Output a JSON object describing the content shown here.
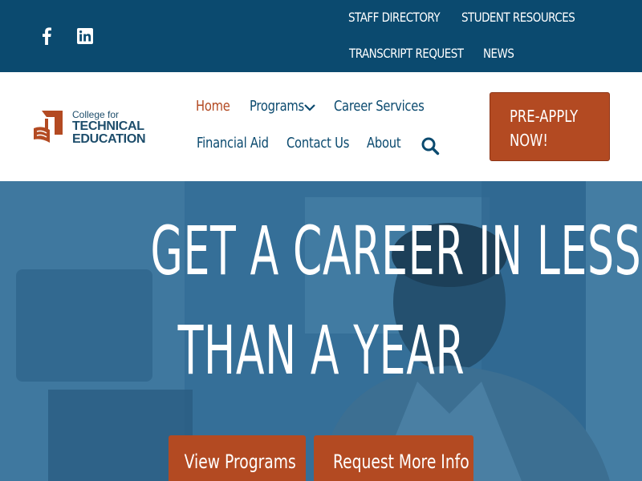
{
  "topbar": {
    "social": [
      "facebook-icon",
      "linkedin-icon"
    ],
    "links": [
      "STAFF DIRECTORY",
      "STUDENT RESOURCES",
      "TRANSCRIPT REQUEST",
      "NEWS"
    ]
  },
  "logo": {
    "line1": "College for",
    "line2": "TECHNICAL",
    "line3": "EDUCATION"
  },
  "nav": {
    "home": "Home",
    "programs": "Programs",
    "career_services": "Career Services",
    "financial_aid": "Financial Aid",
    "contact_us": "Contact Us",
    "about": "About",
    "active": "Home"
  },
  "cta": {
    "line1": "PRE-APPLY",
    "line2": "NOW!"
  },
  "hero": {
    "title_line1": "GET A CAREER IN LESS",
    "title_line2": "THAN A YEAR",
    "buttons": [
      "View Programs",
      "Request More Info"
    ]
  },
  "colors": {
    "brand_blue": "#0b4a6f",
    "accent_orange": "#b34a22",
    "hero_overlay": "#356f98"
  }
}
